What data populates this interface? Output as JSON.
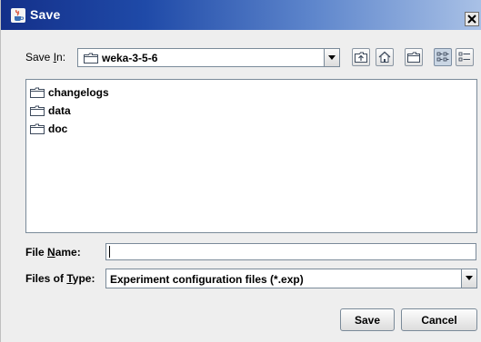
{
  "window": {
    "title": "Save",
    "icon": "java-cup-icon",
    "close_glyph": "x"
  },
  "location": {
    "label_prefix": "Save ",
    "label_mnemonic": "I",
    "label_suffix": "n:",
    "value": "weka-3-5-6",
    "icon": "folder-icon"
  },
  "toolbar": [
    {
      "name": "up-one-level",
      "icon": "up-folder-icon"
    },
    {
      "name": "home",
      "icon": "home-icon"
    },
    {
      "name": "create-new-folder",
      "icon": "new-folder-icon"
    },
    {
      "name": "list-view",
      "icon": "list-view-icon",
      "active": true
    },
    {
      "name": "details-view",
      "icon": "details-view-icon"
    }
  ],
  "files": [
    {
      "name": "changelogs",
      "icon": "folder-icon"
    },
    {
      "name": "data",
      "icon": "folder-icon"
    },
    {
      "name": "doc",
      "icon": "folder-icon"
    }
  ],
  "file_name": {
    "label_prefix": "File ",
    "label_mnemonic": "N",
    "label_suffix": "ame:",
    "value": ""
  },
  "file_type": {
    "label_prefix": "Files of ",
    "label_mnemonic": "T",
    "label_suffix": "ype:",
    "value": "Experiment configuration files (*.exp)"
  },
  "buttons": {
    "save": "Save",
    "cancel": "Cancel"
  },
  "colors": {
    "titlebar_start": "#14308a",
    "titlebar_end": "#a9c1e6",
    "panel_bg": "#eeeeee",
    "control_border": "#7a8a99"
  }
}
